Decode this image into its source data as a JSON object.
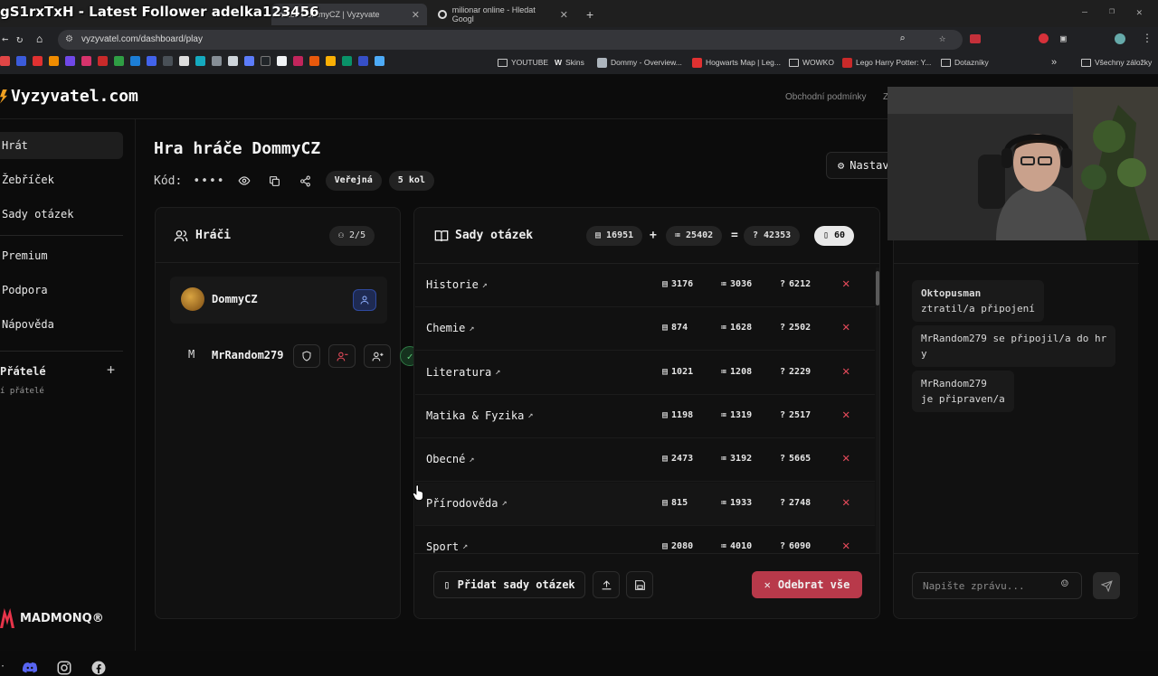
{
  "browser": {
    "overlay_text": "gS1rxTxH - Latest Follower adelka123456",
    "tabs": [
      {
        "label": "hráče DommyCZ | Vyzyvate"
      },
      {
        "label": "milionar online - Hledat Googl"
      }
    ],
    "url": "vyzyvatel.com/dashboard/play",
    "bookmarks": [
      {
        "label": "YOUTUBE"
      },
      {
        "label": "Skins"
      },
      {
        "label": "Dommy - Overview..."
      },
      {
        "label": "Hogwarts Map | Leg..."
      },
      {
        "label": "WOWKO"
      },
      {
        "label": "Lego Harry Potter: Y..."
      },
      {
        "label": "Dotazníky"
      },
      {
        "label": "Všechny záložky"
      }
    ]
  },
  "app": {
    "brand": "Vyzyvatel.com",
    "top_links": [
      "Obchodní podmínky",
      "Z"
    ],
    "sidebar": {
      "items": [
        {
          "label": "Hrát",
          "active": true
        },
        {
          "label": "Žebříček"
        },
        {
          "label": "Sady otázek"
        },
        {
          "label": "Premium"
        },
        {
          "label": "Podpora"
        },
        {
          "label": "Nápověda"
        }
      ],
      "friends_label": "Přátelé",
      "friends_sub": "í přátelé",
      "sponsor": "MADMONQ®"
    },
    "page": {
      "title": "Hra hráče DommyCZ",
      "code_label": "Kód:",
      "code_masked": "••••",
      "visibility_badge": "Veřejná",
      "rounds_badge": "5 kol",
      "settings_button": "Nastav"
    },
    "players_panel": {
      "title": "Hráči",
      "count": "2/5",
      "players": [
        {
          "name": "DommyCZ",
          "avatar": "avatar-image"
        },
        {
          "name": "MrRandom279",
          "initial": "M"
        }
      ]
    },
    "sets_panel": {
      "title": "Sady otázek",
      "totals": {
        "a": "16951",
        "plus": "+",
        "b": "25402",
        "eq": "=",
        "c": "42353",
        "sets": "60"
      },
      "rows": [
        {
          "name": "Historie",
          "a": "3176",
          "b": "3036",
          "c": "6212"
        },
        {
          "name": "Chemie",
          "a": "874",
          "b": "1628",
          "c": "2502"
        },
        {
          "name": "Literatura",
          "a": "1021",
          "b": "1208",
          "c": "2229"
        },
        {
          "name": "Matika & Fyzika",
          "a": "1198",
          "b": "1319",
          "c": "2517"
        },
        {
          "name": "Obecné",
          "a": "2473",
          "b": "3192",
          "c": "5665"
        },
        {
          "name": "Přírodověda",
          "a": "815",
          "b": "1933",
          "c": "2748"
        },
        {
          "name": "Sport",
          "a": "2080",
          "b": "4010",
          "c": "6090"
        }
      ],
      "add_button": "Přidat sady otázek",
      "remove_all_button": "Odebrat vše"
    },
    "chat": {
      "messages": [
        {
          "line1": "Oktopusman",
          "line2": "ztratil/a připojení"
        },
        {
          "line1": "MrRandom279 se připojil/a do hr",
          "line2": "y"
        },
        {
          "line1": "MrRandom279",
          "line2": "je připraven/a"
        }
      ],
      "placeholder": "Napište zprávu..."
    }
  },
  "colors": {
    "accent_red": "#c0394a",
    "remove_x": "#e34a5a",
    "bg": "#0c0c0c"
  }
}
